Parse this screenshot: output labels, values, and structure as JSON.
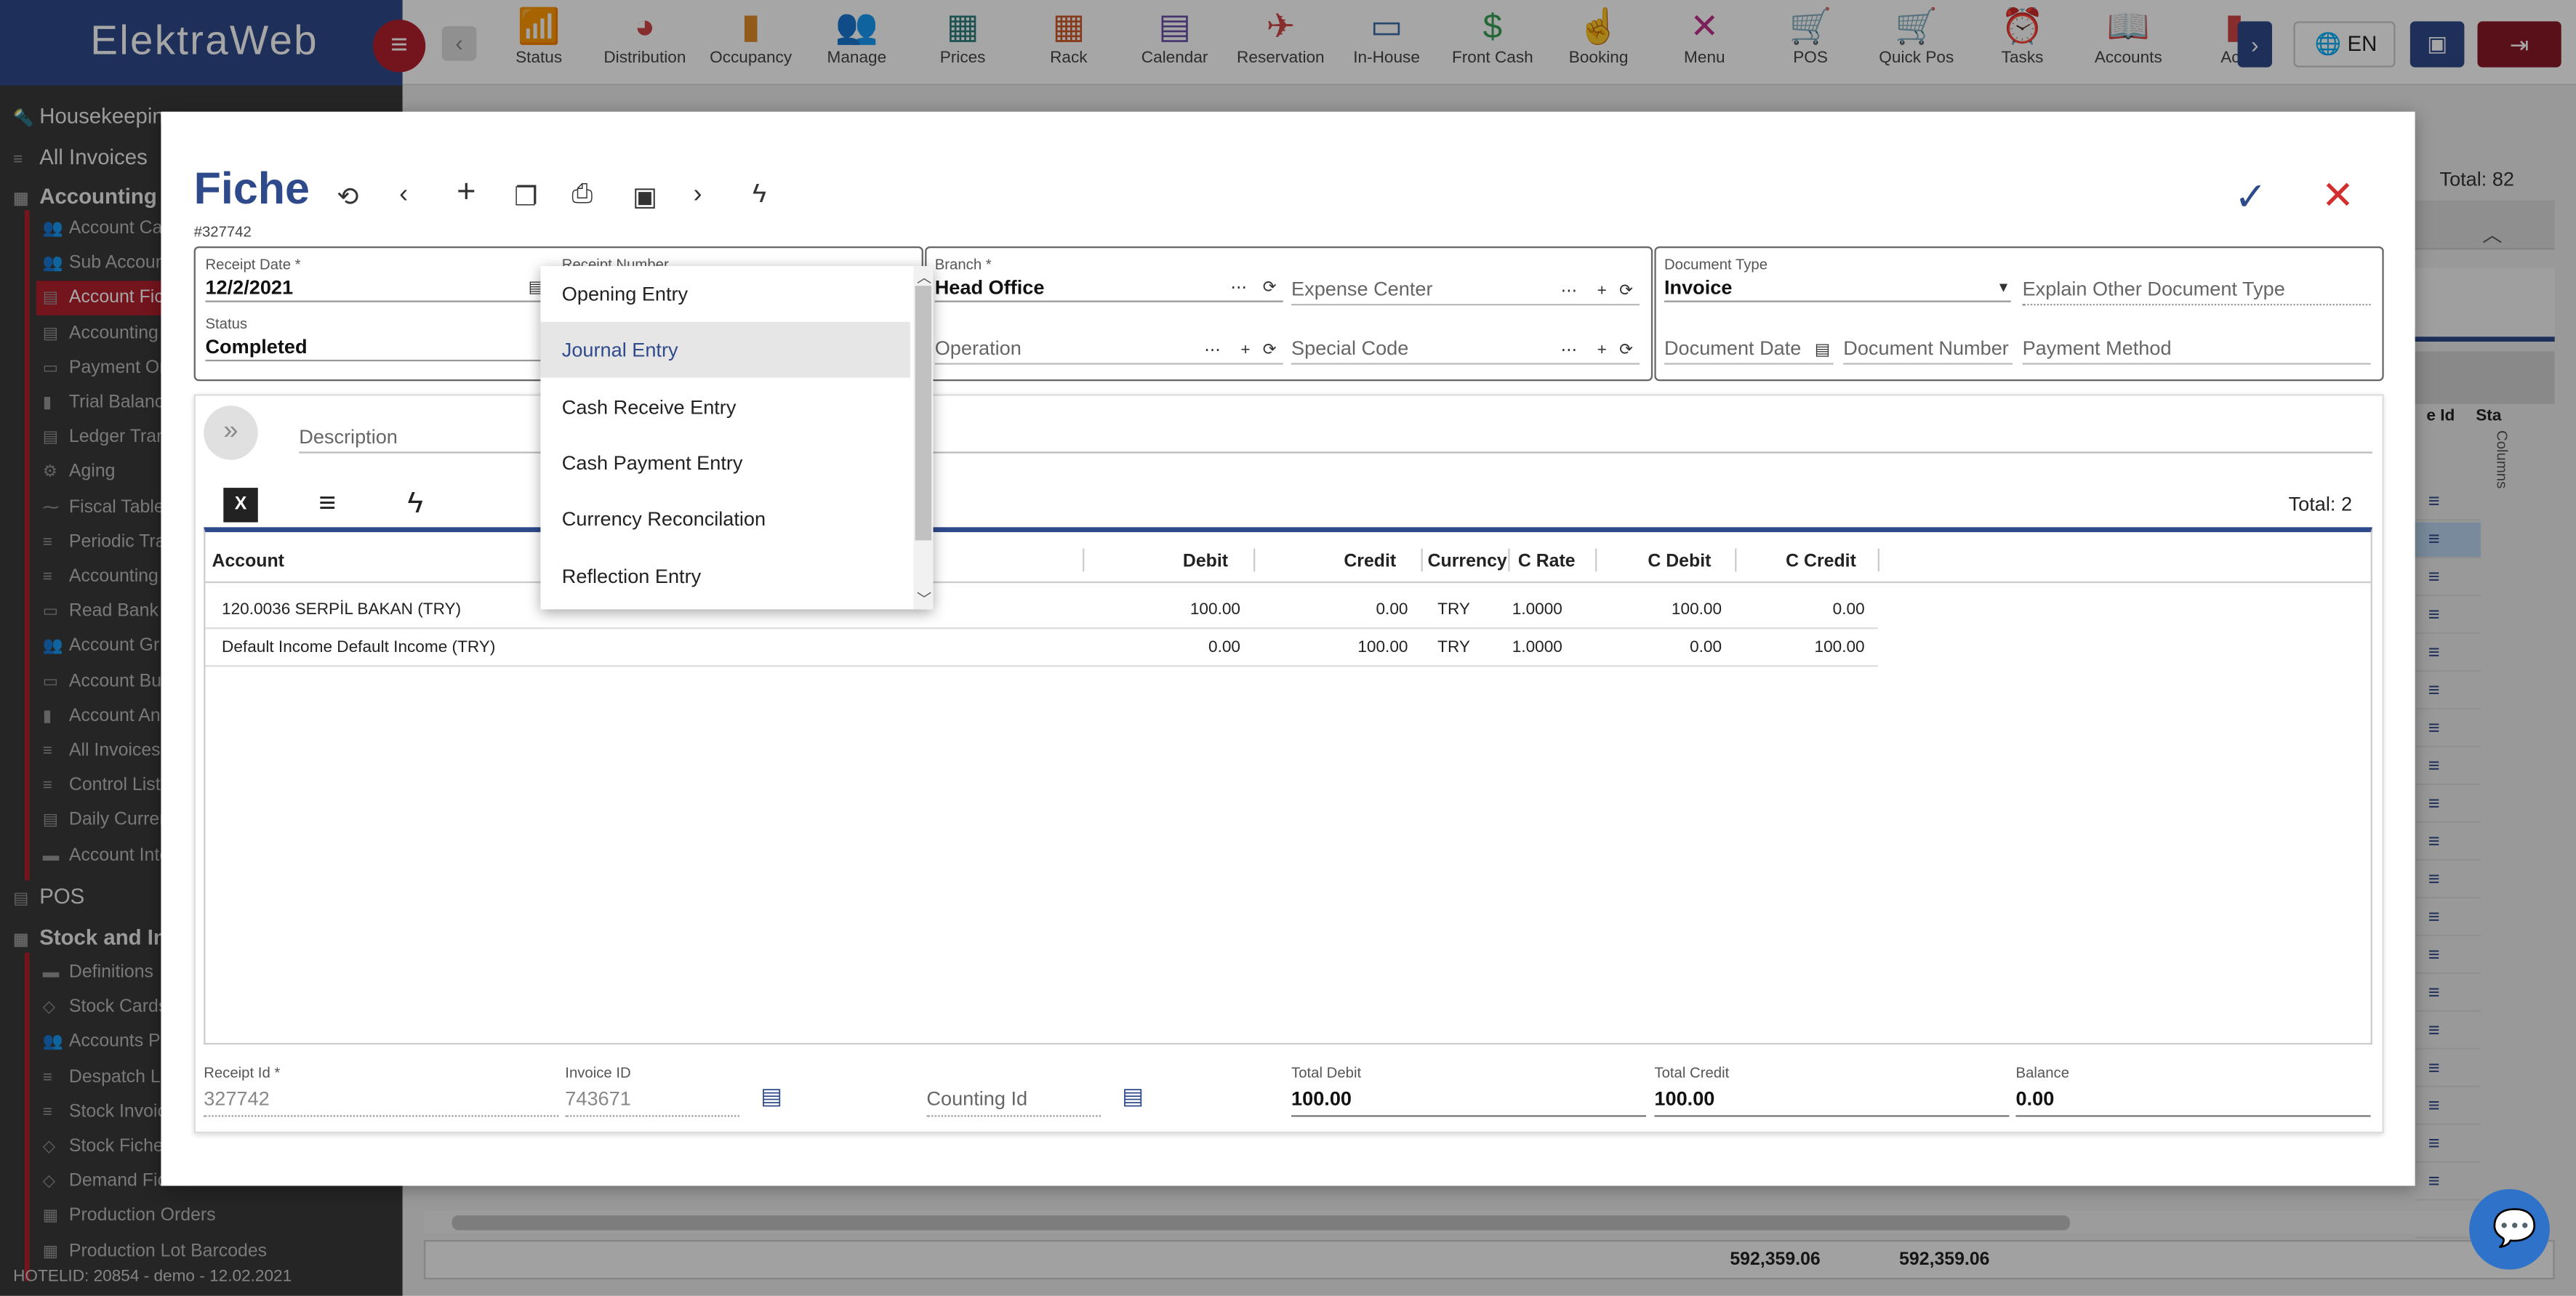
{
  "app": {
    "brand": "ElektraWeb"
  },
  "modules": [
    {
      "label": "Status",
      "icon": "📶",
      "color": "#3a8fd1"
    },
    {
      "label": "Distribution",
      "icon": "◕",
      "color": "#d04545"
    },
    {
      "label": "Occupancy",
      "icon": "▮",
      "color": "#e08a2a"
    },
    {
      "label": "Manage",
      "icon": "👥",
      "color": "#3a6ea8"
    },
    {
      "label": "Prices",
      "icon": "▦",
      "color": "#2e7d7d"
    },
    {
      "label": "Rack",
      "icon": "▦",
      "color": "#d05a2a"
    },
    {
      "label": "Calendar",
      "icon": "▤",
      "color": "#6a4fa8"
    },
    {
      "label": "Reservation",
      "icon": "✈",
      "color": "#d04545"
    },
    {
      "label": "In-House",
      "icon": "▭",
      "color": "#3a6ea8"
    },
    {
      "label": "Front Cash",
      "icon": "$",
      "color": "#3aa055"
    },
    {
      "label": "Booking",
      "icon": "☝",
      "color": "#c0308a"
    },
    {
      "label": "Menu",
      "icon": "✕",
      "color": "#c0308a"
    },
    {
      "label": "POS",
      "icon": "🛒",
      "color": "#d05a2a"
    },
    {
      "label": "Quick Pos",
      "icon": "🛒",
      "color": "#8a3ac0"
    },
    {
      "label": "Tasks",
      "icon": "⏰",
      "color": "#d05a2a"
    },
    {
      "label": "Accounts",
      "icon": "📖",
      "color": "#2e8a8a"
    },
    {
      "label": "Acc",
      "icon": "▮",
      "color": "#d04545"
    }
  ],
  "topright": {
    "lang": "EN"
  },
  "sidebar": {
    "items": [
      {
        "label": "Housekeeping",
        "icon": "🔦",
        "section": true
      },
      {
        "label": "All Invoices",
        "icon": "≡",
        "section": true
      },
      {
        "label": "Accounting",
        "icon": "▦",
        "section": true,
        "bold": true
      },
      {
        "label": "Account Ca",
        "icon": "👥"
      },
      {
        "label": "Sub Accoun",
        "icon": "👥"
      },
      {
        "label": "Account Fic",
        "icon": "▤",
        "active": true
      },
      {
        "label": "Accounting",
        "icon": "▤"
      },
      {
        "label": "Payment Or",
        "icon": "▭"
      },
      {
        "label": "Trial Balanc",
        "icon": "▮"
      },
      {
        "label": "Ledger Tran",
        "icon": "▤"
      },
      {
        "label": "Aging",
        "icon": "⚙"
      },
      {
        "label": "Fiscal Table",
        "icon": "⁓"
      },
      {
        "label": "Periodic Tra",
        "icon": "≡"
      },
      {
        "label": "Accounting",
        "icon": "≡"
      },
      {
        "label": "Read Bank",
        "icon": "▭"
      },
      {
        "label": "Account Gr",
        "icon": "👥"
      },
      {
        "label": "Account Bu",
        "icon": "▭"
      },
      {
        "label": "Account An",
        "icon": "▮"
      },
      {
        "label": "All Invoices",
        "icon": "≡"
      },
      {
        "label": "Control List",
        "icon": "≡"
      },
      {
        "label": "Daily Curren",
        "icon": "▤"
      },
      {
        "label": "Account Inte",
        "icon": "▬"
      },
      {
        "label": "POS",
        "icon": "▤",
        "section": true
      },
      {
        "label": "Stock and In",
        "icon": "▦",
        "section": true,
        "bold": true
      },
      {
        "label": "Definitions",
        "icon": "▬"
      },
      {
        "label": "Stock Cards",
        "icon": "◇"
      },
      {
        "label": "Accounts P",
        "icon": "👥"
      },
      {
        "label": "Despatch Li",
        "icon": "≡"
      },
      {
        "label": "Stock Invoic",
        "icon": "≡"
      },
      {
        "label": "Stock Fiche",
        "icon": "◇"
      },
      {
        "label": "Demand Fiches",
        "icon": "◇"
      },
      {
        "label": "Production Orders",
        "icon": "▦"
      },
      {
        "label": "Production Lot Barcodes",
        "icon": "▦"
      }
    ],
    "hotel_info": "HOTELID: 20854 - demo - 12.02.2021"
  },
  "background": {
    "total": "Total: 82",
    "col_id": "e Id",
    "col_sta": "Sta",
    "columns_label": "Columns",
    "sum_debit": "592,359.06",
    "sum_credit": "592,359.06"
  },
  "fiche": {
    "title": "Fiche",
    "id": "#327742",
    "receipt_date": {
      "label": "Receipt Date *",
      "value": "12/2/2021"
    },
    "receipt_number": {
      "label": "Receipt Number"
    },
    "status": {
      "label": "Status",
      "value": "Completed"
    },
    "branch": {
      "label": "Branch *",
      "value": "Head Office"
    },
    "expense_center": {
      "placeholder": "Expense Center"
    },
    "operation": {
      "placeholder": "Operation"
    },
    "special_code": {
      "placeholder": "Special Code"
    },
    "document_type": {
      "label": "Document Type",
      "value": "Invoice"
    },
    "explain_other": {
      "placeholder": "Explain Other Document Type"
    },
    "document_date": {
      "placeholder": "Document Date"
    },
    "document_number": {
      "placeholder": "Document Number"
    },
    "payment_method": {
      "placeholder": "Payment Method"
    },
    "description": {
      "placeholder": "Description"
    },
    "grid_total": "Total: 2"
  },
  "dropdown": {
    "options": [
      "Opening Entry",
      "Journal Entry",
      "Cash Receive Entry",
      "Cash Payment Entry",
      "Currency Reconcilation",
      "Reflection Entry"
    ],
    "selected": "Journal Entry"
  },
  "table": {
    "headers": {
      "account": "Account",
      "debit": "Debit",
      "credit": "Credit",
      "currency": "Currency",
      "c_rate": "C Rate",
      "c_debit": "C Debit",
      "c_credit": "C Credit"
    },
    "rows": [
      {
        "account": "120.0036 SERPİL BAKAN (TRY)",
        "debit": "100.00",
        "credit": "0.00",
        "currency": "TRY",
        "c_rate": "1.0000",
        "c_debit": "100.00",
        "c_credit": "0.00"
      },
      {
        "account": "Default Income Default Income (TRY)",
        "debit": "0.00",
        "credit": "100.00",
        "currency": "TRY",
        "c_rate": "1.0000",
        "c_debit": "0.00",
        "c_credit": "100.00"
      }
    ]
  },
  "footer": {
    "receipt_id": {
      "label": "Receipt Id *",
      "value": "327742"
    },
    "invoice_id": {
      "label": "Invoice ID",
      "value": "743671"
    },
    "counting_id": {
      "placeholder": "Counting Id"
    },
    "total_debit": {
      "label": "Total Debit",
      "value": "100.00"
    },
    "total_credit": {
      "label": "Total Credit",
      "value": "100.00"
    },
    "balance": {
      "label": "Balance",
      "value": "0.00"
    }
  },
  "colors": {
    "brand": "#2e4a8b",
    "accent_red": "#b21f2d",
    "ok": "#2e4a8b",
    "cancel": "#d32f2f"
  }
}
